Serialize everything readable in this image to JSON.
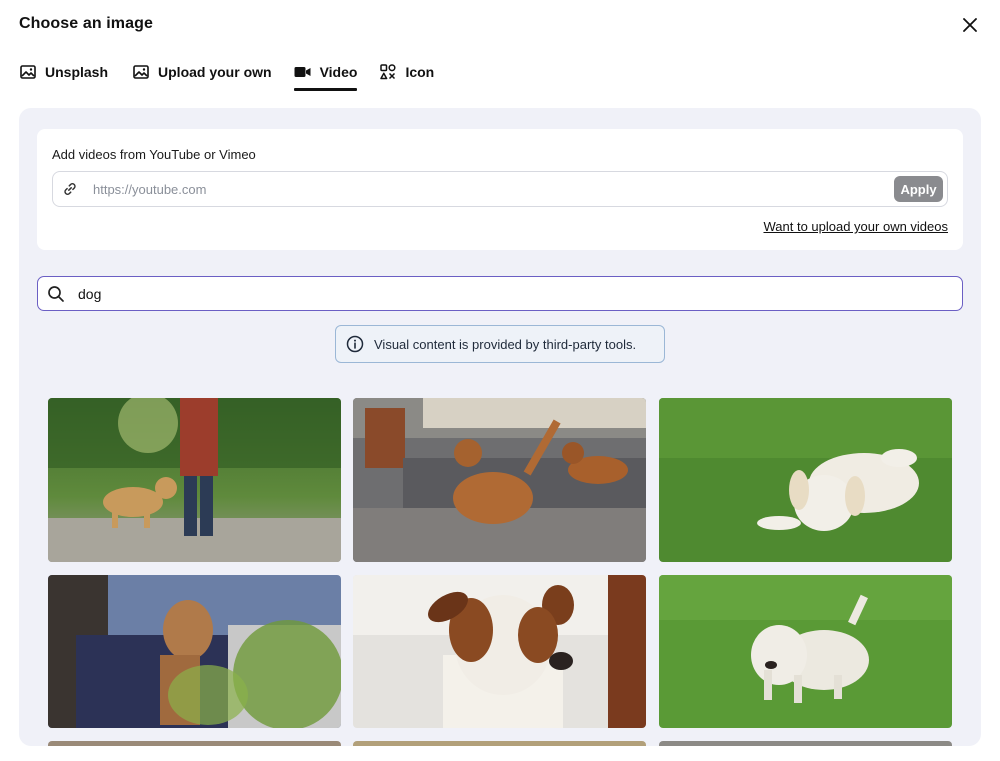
{
  "dialog": {
    "title": "Choose an image"
  },
  "tabs": [
    {
      "label": "Unsplash",
      "icon": "image-icon",
      "active": false
    },
    {
      "label": "Upload your own",
      "icon": "image-icon",
      "active": false
    },
    {
      "label": "Video",
      "icon": "video-camera-icon",
      "active": true
    },
    {
      "label": "Icon",
      "icon": "shapes-icon",
      "active": false
    }
  ],
  "video_section": {
    "label": "Add videos from YouTube or Vimeo",
    "url_placeholder": "https://youtube.com",
    "url_value": "",
    "apply_label": "Apply",
    "upload_link": "Want to upload your own videos"
  },
  "search": {
    "value": "dog",
    "placeholder": ""
  },
  "notice": {
    "text": "Visual content is provided by third-party tools."
  },
  "results": [
    {
      "description": "golden retriever walking on park path next to person"
    },
    {
      "description": "two dachshund puppies playing in front of a mirror"
    },
    {
      "description": "white golden retriever puppy lying on grass"
    },
    {
      "description": "brown dog on couch behind leaves"
    },
    {
      "description": "jack russell terrier portrait close-up"
    },
    {
      "description": "west highland white terrier walking on grass"
    }
  ],
  "colors": {
    "accent": "#6b5fc4",
    "panel_bg": "#f0f1f8",
    "apply_bg": "#8a8b8f",
    "notice_border": "#9bb7d6"
  }
}
